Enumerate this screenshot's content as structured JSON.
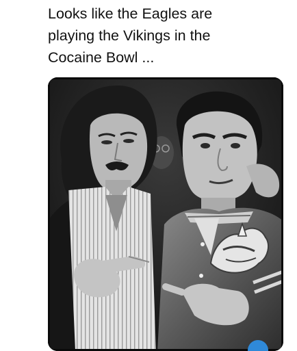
{
  "post": {
    "caption_lines": [
      "Looks like the Eagles are",
      "playing the Vikings in the",
      "Cocaine Bowl ..."
    ]
  },
  "photo": {
    "style": "black-and-white",
    "subject": "two-men-pointing-at-jacket-logo"
  },
  "colors": {
    "text": "#111111",
    "badge": "#2f89d8"
  }
}
